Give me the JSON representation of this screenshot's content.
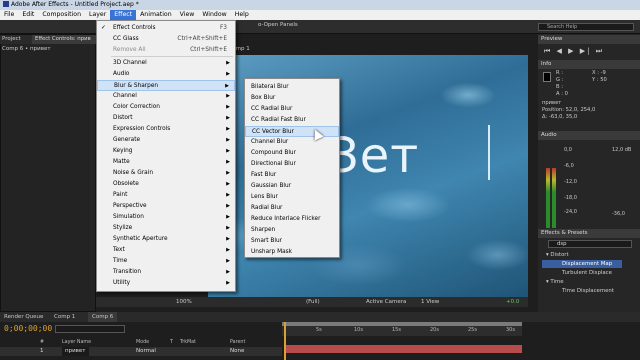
{
  "window": {
    "title": "Adobe After Effects - Untitled Project.aep *"
  },
  "menubar": [
    "File",
    "Edit",
    "Composition",
    "Layer",
    "Effect",
    "Animation",
    "View",
    "Window",
    "Help"
  ],
  "menubar_active": "Effect",
  "toolbar": {
    "workspace_label": "o-Open Panels",
    "search_help": "Search Help"
  },
  "project": {
    "project_tab": "Project",
    "effect_controls_tab": "Effect Controls: прив",
    "comp_row": "Comp 6 • привет"
  },
  "viewer": {
    "tab": "Solid 5 Comp 1",
    "text_layer": "Зет",
    "footer": {
      "zoom": "100%",
      "resolution": "(Full)",
      "camera": "Active Camera",
      "views": "1 View",
      "exposure": "+0.0"
    }
  },
  "effect_menu": {
    "items": [
      {
        "label": "Effect Controls",
        "shortcut": "F3",
        "checked": true
      },
      {
        "label": "CC Glass",
        "shortcut": "Ctrl+Alt+Shift+E"
      },
      {
        "label": "Remove All",
        "shortcut": "Ctrl+Shift+E",
        "disabled": true
      },
      {
        "label": "3D Channel"
      },
      {
        "label": "Audio"
      },
      {
        "label": "Blur & Sharpen",
        "highlighted": true
      },
      {
        "label": "Channel"
      },
      {
        "label": "Color Correction"
      },
      {
        "label": "Distort"
      },
      {
        "label": "Expression Controls"
      },
      {
        "label": "Generate"
      },
      {
        "label": "Keying"
      },
      {
        "label": "Matte"
      },
      {
        "label": "Noise & Grain"
      },
      {
        "label": "Obsolete"
      },
      {
        "label": "Paint"
      },
      {
        "label": "Perspective"
      },
      {
        "label": "Simulation"
      },
      {
        "label": "Stylize"
      },
      {
        "label": "Synthetic Aperture"
      },
      {
        "label": "Text"
      },
      {
        "label": "Time"
      },
      {
        "label": "Transition"
      },
      {
        "label": "Utility"
      }
    ]
  },
  "blur_submenu": {
    "items": [
      "Bilateral Blur",
      "Box Blur",
      "CC Radial Blur",
      "CC Radial Fast Blur",
      "CC Vector Blur",
      "Channel Blur",
      "Compound Blur",
      "Directional Blur",
      "Fast Blur",
      "Gaussian Blur",
      "Lens Blur",
      "Radial Blur",
      "Reduce Interlace Flicker",
      "Sharpen",
      "Smart Blur",
      "Unsharp Mask"
    ],
    "highlighted": "CC Vector Blur"
  },
  "right_panels": {
    "preview": "Preview",
    "preview_controls": "⏮ ◀ ▶ ▶| ⏭",
    "info": "Info",
    "info_lines": [
      "R :",
      "G :",
      "B :",
      "A : 0",
      "X : -9",
      "Y : 50",
      "привет",
      "Position: 52,0, 254,0",
      "Δ: -63,0, 35,0"
    ],
    "audio": "Audio",
    "audio_scale": [
      "0,0",
      "12,0 dB",
      "-6,0",
      "-12,0",
      "-18,0",
      "-24,0",
      "-36,0"
    ],
    "effects_presets": "Effects & Presets",
    "effects_search": "dsp",
    "tree": [
      {
        "label": "▾ Distort",
        "level": 0
      },
      {
        "label": "Displacement Map",
        "level": 1,
        "selected": true
      },
      {
        "label": "Turbulent Displace",
        "level": 1
      },
      {
        "label": "▾ Time",
        "level": 0
      },
      {
        "label": "Time Displacement",
        "level": 1
      }
    ]
  },
  "timeline": {
    "tabs": [
      "Render Queue",
      "Comp 1",
      "Comp 6"
    ],
    "timecode": "0;00;00;00",
    "ruler": [
      "5s",
      "10s",
      "15s",
      "20s",
      "25s",
      "30s"
    ],
    "columns": [
      "#",
      "Layer Name",
      "Mode",
      "T",
      "TrkMat",
      "Parent"
    ],
    "layer": {
      "index": "1",
      "name": "привет",
      "mode": "Normal",
      "parent": "None"
    }
  },
  "colors": {
    "menu_highlight": "#3874d8",
    "timecode": "#d9a033",
    "selection": "#3a5fa0",
    "layer_bar": "#b84c4c"
  }
}
